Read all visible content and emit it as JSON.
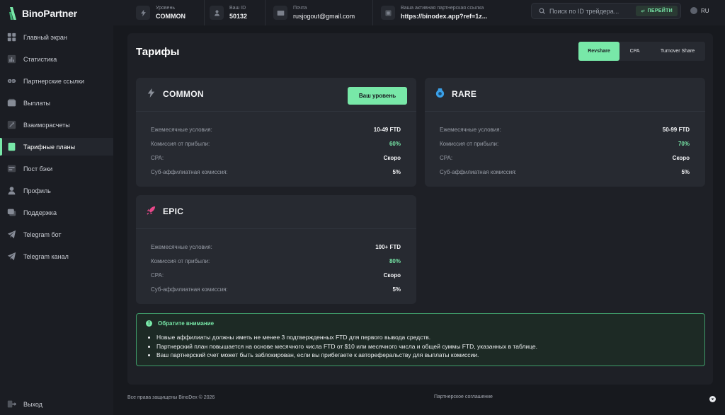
{
  "app": {
    "logo_text": "BinoPartner"
  },
  "sidebar": {
    "items": [
      {
        "label": "Главный экран",
        "icon": "home-icon"
      },
      {
        "label": "Статистика",
        "icon": "chart-icon"
      },
      {
        "label": "Партнерские ссылки",
        "icon": "link-icon"
      },
      {
        "label": "Выплаты",
        "icon": "wallet-icon"
      },
      {
        "label": "Взаиморасчеты",
        "icon": "transfer-icon"
      },
      {
        "label": "Тарифные планы",
        "icon": "tariff-icon",
        "active": true
      },
      {
        "label": "Пост бэки",
        "icon": "postback-icon"
      },
      {
        "label": "Профиль",
        "icon": "user-icon"
      },
      {
        "label": "Поддержка",
        "icon": "support-icon"
      },
      {
        "label": "Telegram бот",
        "icon": "telegram-icon"
      },
      {
        "label": "Telegram канал",
        "icon": "telegram-icon"
      }
    ],
    "logout_label": "Выход"
  },
  "header": {
    "level_label": "Уровень",
    "level_value": "COMMON",
    "id_label": "Ваш ID",
    "id_value": "50132",
    "email_label": "Почта",
    "email_value": "rusjogout@gmail.com",
    "link_label": "Ваша активная партнерская ссылка",
    "link_value": "https://binodex.app?ref=1z...",
    "search_placeholder": "Поиск по ID трейдера...",
    "go_label": "ПЕРЕЙТИ",
    "lang": "RU"
  },
  "page": {
    "title": "Тарифы",
    "tabs": [
      "Revshare",
      "CPA",
      "Turnover Share"
    ]
  },
  "plans": [
    {
      "name": "COMMON",
      "is_current": true,
      "current_label": "Ваш уровень",
      "rows": [
        {
          "key": "Ежемесячные условия:",
          "value": "10-49 FTD"
        },
        {
          "key": "Комиссия от прибыли:",
          "value": "60%"
        },
        {
          "key": "CPA:",
          "value": "Скоро"
        },
        {
          "key": "Суб-аффилиатная комиссия:",
          "value": "5%"
        }
      ]
    },
    {
      "name": "RARE",
      "rows": [
        {
          "key": "Ежемесячные условия:",
          "value": "50-99 FTD"
        },
        {
          "key": "Комиссия от прибыли:",
          "value": "70%"
        },
        {
          "key": "CPA:",
          "value": "Скоро"
        },
        {
          "key": "Суб-аффилиатная комиссия:",
          "value": "5%"
        }
      ]
    },
    {
      "name": "EPIC",
      "rows": [
        {
          "key": "Ежемесячные условия:",
          "value": "100+ FTD"
        },
        {
          "key": "Комиссия от прибыли:",
          "value": "80%"
        },
        {
          "key": "CPA:",
          "value": "Скоро"
        },
        {
          "key": "Суб-аффилиатная комиссия:",
          "value": "5%"
        }
      ]
    }
  ],
  "notice": {
    "title": "Обратите внимание",
    "items": [
      "Новые аффилиаты должны иметь не менее 3 подтвержденных FTD для первого вывода средств.",
      "Партнерский план повышается на основе месячного числа FTD от $10 или месячного числа и общей суммы FTD, указанных в таблице.",
      "Ваш партнерский счет может быть заблокирован, если вы прибегаете к автореферальству для выплаты комиссии."
    ]
  },
  "footer": {
    "copyright": "Все права защищены BinoDex © 2026",
    "agreement": "Партнерское соглашение"
  },
  "colors": {
    "accent": "#78e8a8",
    "rare": "#3aa0e8",
    "epic": "#e8488a",
    "common": "#8a8f99"
  }
}
